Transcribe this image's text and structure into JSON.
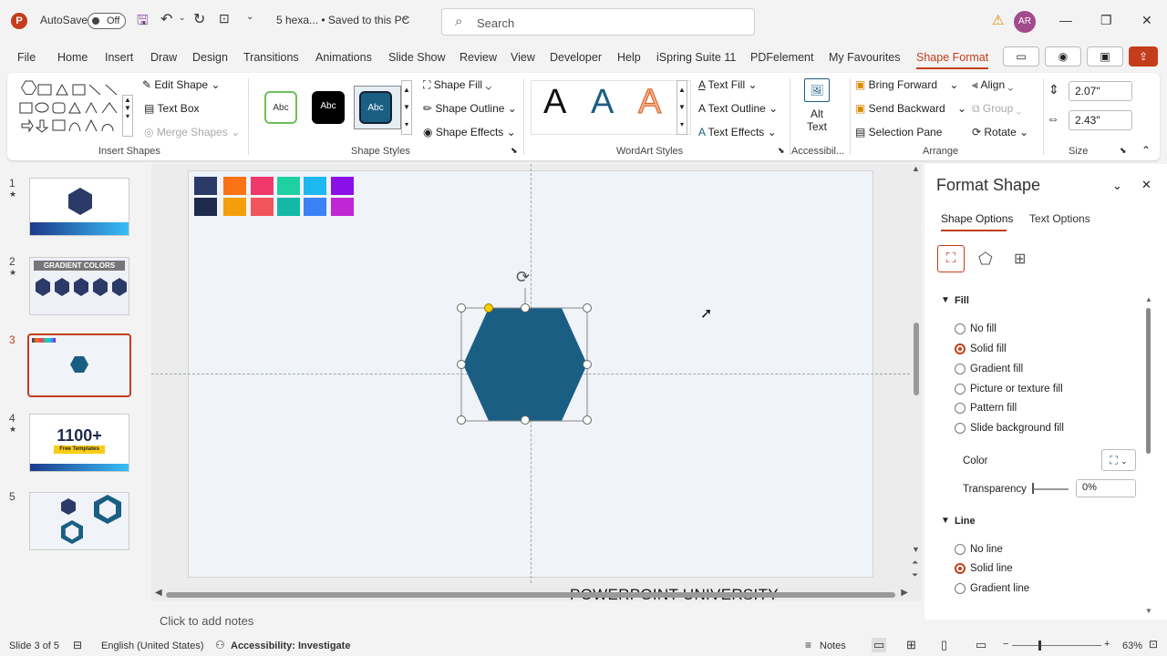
{
  "titlebar": {
    "autosave_label": "AutoSave",
    "autosave_state": "Off",
    "doc_title": "5 hexa... • Saved to this PC",
    "search_placeholder": "Search",
    "user_initials": "AR"
  },
  "menu": {
    "items": [
      "File",
      "Home",
      "Insert",
      "Draw",
      "Design",
      "Transitions",
      "Animations",
      "Slide Show",
      "Review",
      "View",
      "Developer",
      "Help",
      "iSpring Suite 11",
      "PDFelement",
      "My Favourites",
      "Shape Format"
    ],
    "active": "Shape Format"
  },
  "ribbon": {
    "insert_shapes": {
      "label": "Insert Shapes",
      "edit_shape": "Edit Shape",
      "text_box": "Text Box",
      "merge_shapes": "Merge Shapes"
    },
    "shape_styles": {
      "label": "Shape Styles",
      "swatch_text": "Abc",
      "fill": "Shape Fill",
      "outline": "Shape Outline",
      "effects": "Shape Effects"
    },
    "wordart": {
      "label": "WordArt Styles",
      "letter": "A",
      "text_fill": "Text Fill",
      "text_outline": "Text Outline",
      "text_effects": "Text Effects"
    },
    "accessibility": {
      "label": "Accessibil...",
      "alt_text_1": "Alt",
      "alt_text_2": "Text"
    },
    "arrange": {
      "label": "Arrange",
      "bring_forward": "Bring Forward",
      "send_backward": "Send Backward",
      "selection_pane": "Selection Pane",
      "align": "Align",
      "group": "Group",
      "rotate": "Rotate"
    },
    "size": {
      "label": "Size",
      "height": "2.07\"",
      "width": "2.43\""
    }
  },
  "slides": {
    "numbers": [
      "1",
      "2",
      "3",
      "4",
      "5"
    ],
    "star": "★",
    "selected": 3,
    "thumb2_title": "GRADIENT COLORS",
    "thumb4_big": "1100+",
    "thumb4_small": "Free Templates"
  },
  "slide": {
    "palette_top": [
      "#2b3a67",
      "#f97316",
      "#f0386b",
      "#1fd1a0",
      "#1eb8f0",
      "#8b10e8"
    ],
    "palette_bottom": [
      "#1e2a4a",
      "#f59e0b",
      "#f2545b",
      "#14b8a6",
      "#3b82f6",
      "#c026d3"
    ],
    "hexagon_color": "#1b5e84",
    "footer_text": "POWERPOINT UNIVERSITY"
  },
  "format_pane": {
    "title": "Format Shape",
    "tab_shape": "Shape Options",
    "tab_text": "Text Options",
    "fill_header": "Fill",
    "fill_options": [
      "No fill",
      "Solid fill",
      "Gradient fill",
      "Picture or texture fill",
      "Pattern fill",
      "Slide background fill"
    ],
    "fill_selected": "Solid fill",
    "color_label": "Color",
    "transparency_label": "Transparency",
    "transparency_value": "0%",
    "line_header": "Line",
    "line_options": [
      "No line",
      "Solid line",
      "Gradient line"
    ],
    "line_selected": "Solid line"
  },
  "notes_placeholder": "Click to add notes",
  "status": {
    "slide": "Slide 3 of 5",
    "language": "English (United States)",
    "accessibility": "Accessibility: Investigate",
    "notes": "Notes",
    "zoom": "63%"
  },
  "colors": {
    "accent": "#c43e1c",
    "ribbon_bg": "#ffffff",
    "chrome_bg": "#f3f3f3"
  }
}
